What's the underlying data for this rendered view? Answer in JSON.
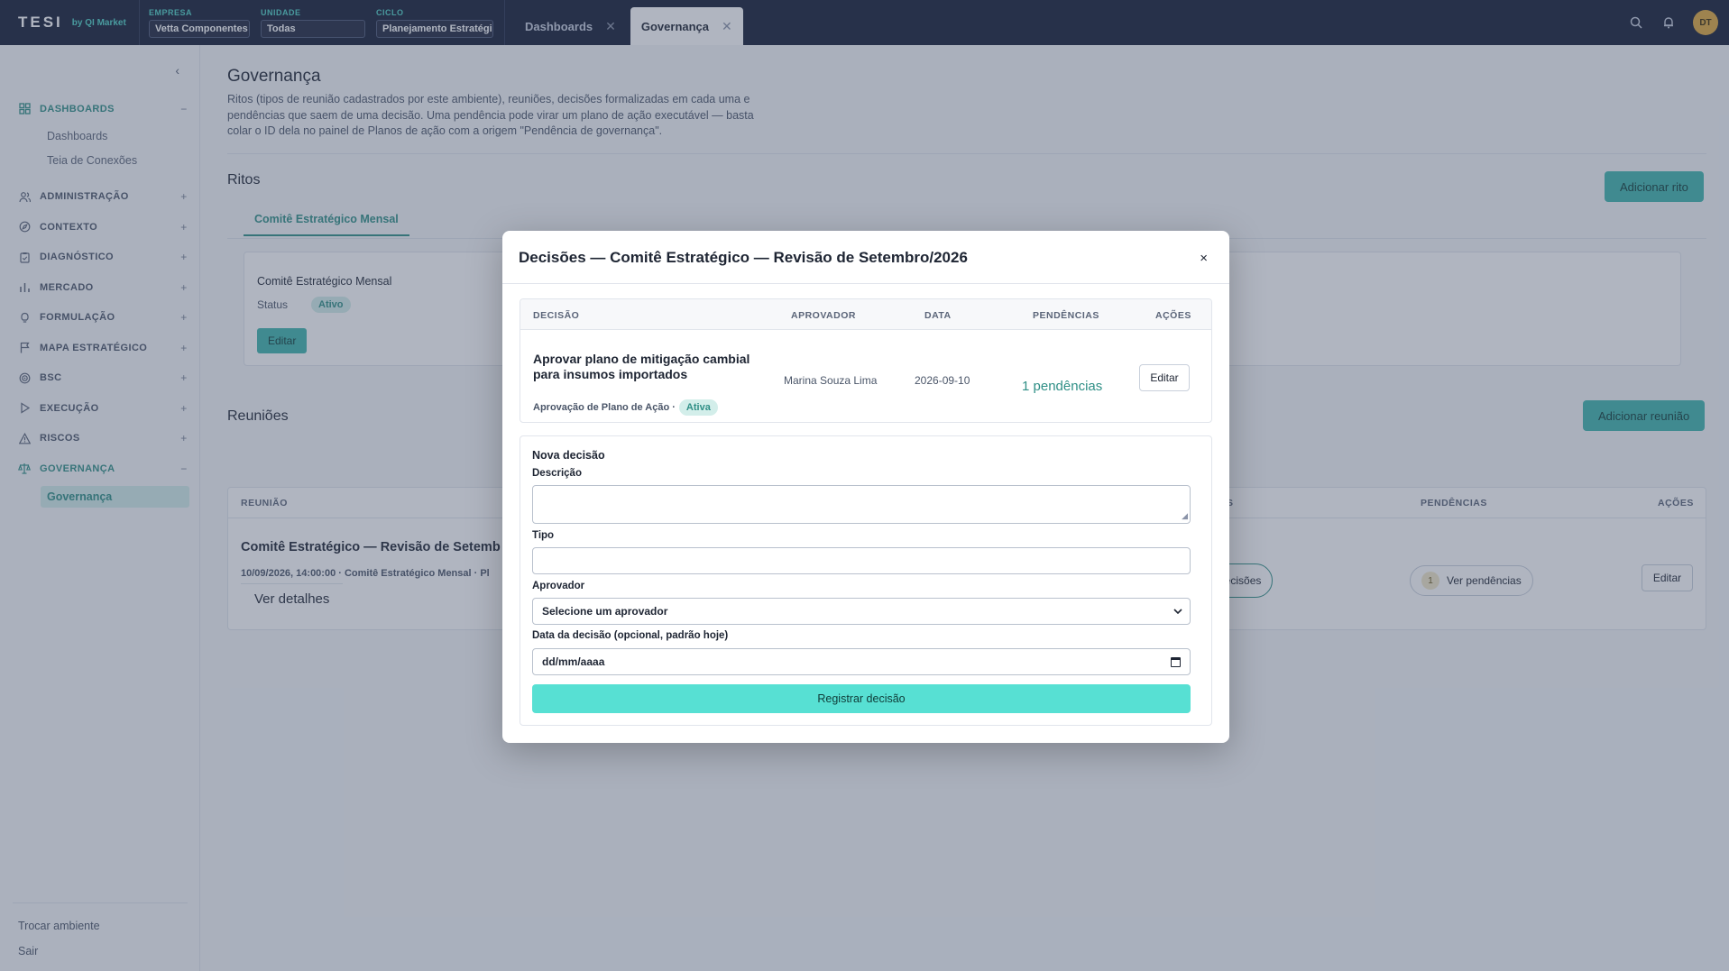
{
  "topbar": {
    "logo": "TESI",
    "logo_sub": "by QI Market",
    "empresa_label": "EMPRESA",
    "empresa_value": "Vetta Componentes",
    "unidade_label": "UNIDADE",
    "unidade_value": "Todas",
    "ciclo_label": "CICLO",
    "ciclo_value": "Planejamento Estratégi",
    "tabs": [
      {
        "label": "Dashboards",
        "active": false
      },
      {
        "label": "Governança",
        "active": true
      }
    ],
    "avatar": "DT"
  },
  "sidebar": {
    "sections": [
      {
        "label": "DASHBOARDS",
        "toggle": "−",
        "icon": "grid-icon",
        "open": true
      },
      {
        "label": "ADMINISTRAÇÃO",
        "toggle": "+",
        "icon": "users-icon"
      },
      {
        "label": "CONTEXTO",
        "toggle": "+",
        "icon": "compass-icon"
      },
      {
        "label": "DIAGNÓSTICO",
        "toggle": "+",
        "icon": "clipboard-icon"
      },
      {
        "label": "MERCADO",
        "toggle": "+",
        "icon": "bar-chart-icon"
      },
      {
        "label": "FORMULAÇÃO",
        "toggle": "+",
        "icon": "lightbulb-icon"
      },
      {
        "label": "MAPA ESTRATÉGICO",
        "toggle": "+",
        "icon": "flag-icon"
      },
      {
        "label": "BSC",
        "toggle": "+",
        "icon": "target-icon"
      },
      {
        "label": "EXECUÇÃO",
        "toggle": "+",
        "icon": "play-icon"
      },
      {
        "label": "RISCOS",
        "toggle": "+",
        "icon": "warning-icon"
      },
      {
        "label": "GOVERNANÇA",
        "toggle": "−",
        "icon": "scale-icon",
        "open": true
      }
    ],
    "dashboards_sub": [
      "Dashboards",
      "Teia de Conexões"
    ],
    "governanca_sub": "Governança",
    "footer": [
      "Trocar ambiente",
      "Sair"
    ]
  },
  "main": {
    "title": "Governança",
    "description": "Ritos (tipos de reunião cadastrados por este ambiente), reuniões, decisões formalizadas em cada uma e pendências que saem de uma decisão. Uma pendência pode virar um plano de ação executável — basta colar o ID dela no painel de Planos de ação com a origem \"Pendência de governança\".",
    "ritos_title": "Ritos",
    "add_rito": "Adicionar rito",
    "rito_tab": "Comitê Estratégico Mensal",
    "rito_card": {
      "name": "Comitê Estratégico Mensal",
      "status_label": "Status",
      "status": "Ativo",
      "edit": "Editar"
    },
    "reunioes_title": "Reuniões",
    "add_reuniao": "Adicionar reunião",
    "reunioes_table": {
      "headers": [
        "REUNIÃO",
        "S",
        "PENDÊNCIAS",
        "AÇÕES"
      ],
      "row": {
        "title": "Comitê Estratégico — Revisão de Setemb",
        "sub": "10/09/2026, 14:00:00 · Comitê Estratégico Mensal · Pl",
        "details": "Ver detalhes",
        "decisoes": "decisões",
        "pend_count": "1",
        "pend_label": "Ver pendências",
        "edit": "Editar"
      }
    }
  },
  "modal": {
    "title": "Decisões — Comitê Estratégico — Revisão de Setembro/2026",
    "close": "×",
    "table": {
      "headers": [
        "DECISÃO",
        "APROVADOR",
        "DATA",
        "PENDÊNCIAS",
        "AÇÕES"
      ],
      "row": {
        "description": "Aprovar plano de mitigação cambial para insumos importados",
        "meta": "Aprovação de Plano de Ação ·",
        "status": "Ativa",
        "approver": "Marina Souza Lima",
        "date": "2026-09-10",
        "pendencias": "1 pendências",
        "edit": "Editar"
      }
    },
    "form": {
      "title": "Nova decisão",
      "descricao_label": "Descrição",
      "descricao_value": "",
      "tipo_label": "Tipo",
      "tipo_value": "",
      "aprovador_label": "Aprovador",
      "aprovador_value": "Selecione um aprovador",
      "data_label": "Data da decisão (opcional, padrão hoje)",
      "data_placeholder": "dd/mm/aaaa",
      "submit": "Registrar decisão"
    }
  }
}
